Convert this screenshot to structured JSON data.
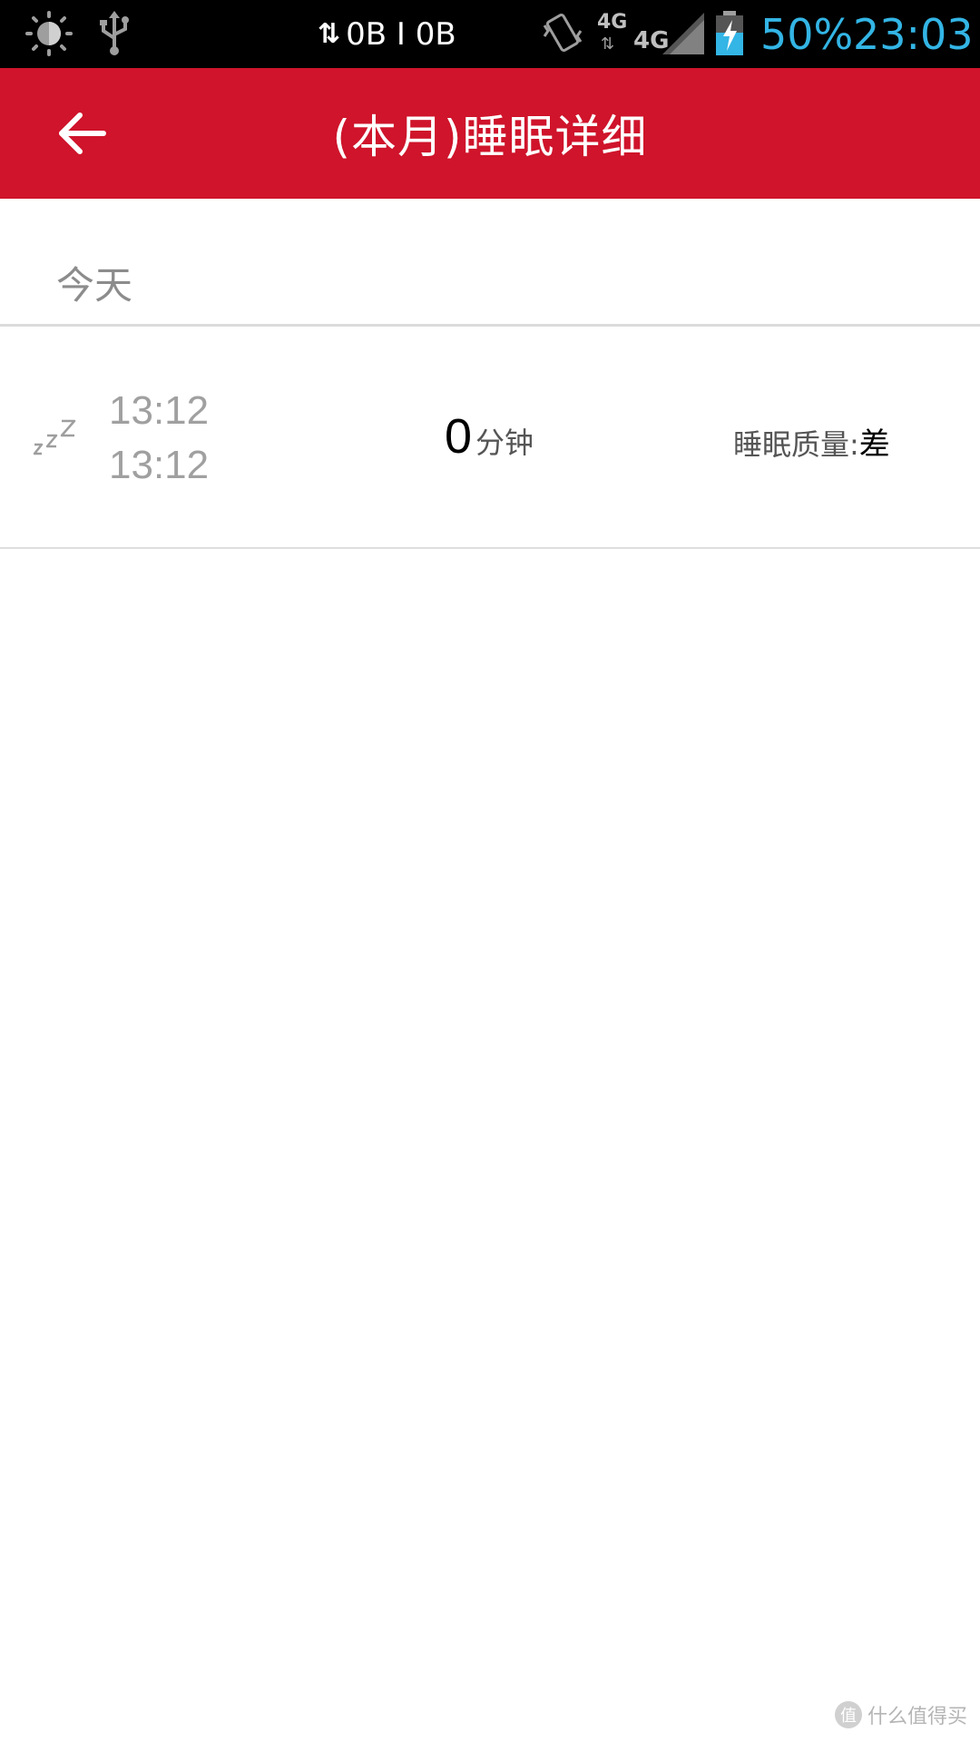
{
  "status_bar": {
    "net_speed": "0B I 0B",
    "network_labels": [
      "4G",
      "4G"
    ],
    "battery_percent": "50%",
    "time": "23:03",
    "icons": [
      "brightness-icon",
      "usb-icon",
      "data-transfer-icon",
      "vibrate-icon",
      "signal-icon",
      "battery-charging-icon"
    ]
  },
  "app_bar": {
    "title": "(本月)睡眠详细",
    "back_icon": "arrow-left-icon",
    "color": "#cf142b"
  },
  "section": {
    "label": "今天"
  },
  "records": [
    {
      "icon": "sleep-zzz-icon",
      "start_time": "13:12",
      "end_time": "13:12",
      "duration_value": "0",
      "duration_unit": "分钟",
      "quality_label": "睡眠质量:",
      "quality_value": "差"
    }
  ],
  "watermark": {
    "badge": "值",
    "text": "什么值得买"
  }
}
